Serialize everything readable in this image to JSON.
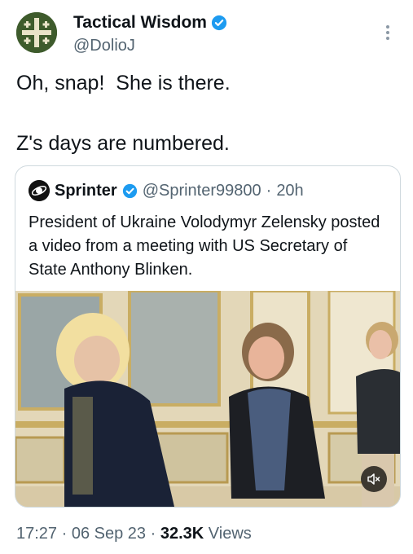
{
  "author": {
    "name": "Tactical Wisdom",
    "handle": "@DolioJ",
    "verified_color": "#1d9bf0",
    "avatar_icon": "jerusalem-cross-icon"
  },
  "tweet": {
    "line1": "Oh, snap!  She is there.",
    "line2": "Z's days are numbered."
  },
  "quoted": {
    "name": "Sprinter",
    "handle": "@Sprinter99800",
    "separator": "·",
    "time": "20h",
    "text": "President of Ukraine Volodymyr Zelensky posted a video from a meeting with US Secretary of State Anthony Blinken.",
    "media_icon": "video-thumbnail",
    "mute_icon": "muted-speaker-icon"
  },
  "meta": {
    "time": "17:27",
    "sep1": "·",
    "date": "06 Sep 23",
    "sep2": "·",
    "views_count": "32.3K",
    "views_label": "Views"
  }
}
